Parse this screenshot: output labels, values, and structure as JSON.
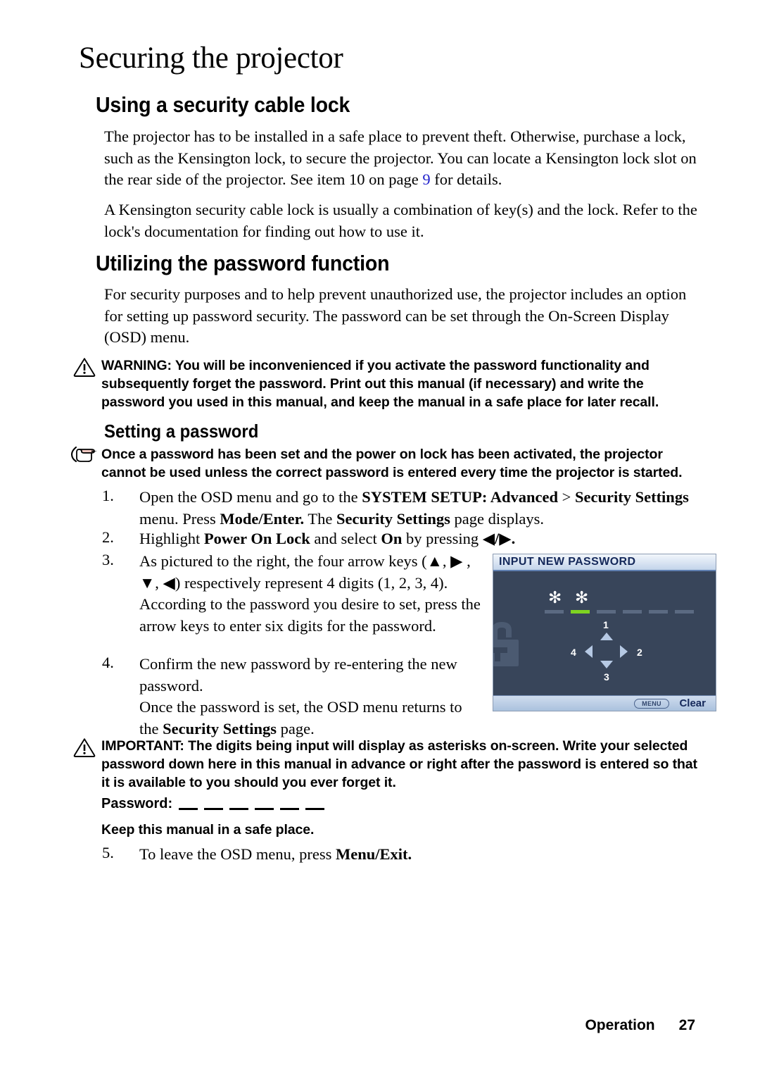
{
  "page": {
    "title": "Securing the projector",
    "footer": {
      "section": "Operation",
      "page_number": "27"
    }
  },
  "sections": [
    {
      "heading": "Using a security cable lock",
      "paragraphs": [
        {
          "pre": "The projector has to be installed in a safe place to prevent theft. Otherwise, purchase a lock, such as the Kensington lock, to secure the projector. You can locate a Kensington lock slot on the rear side of the projector. See item 10 on page ",
          "link": "9",
          "post": " for details."
        },
        {
          "pre": "A Kensington security cable lock is usually a combination of key(s) and the lock. Refer to the lock's documentation for finding out how to use it.",
          "link": "",
          "post": ""
        }
      ]
    },
    {
      "heading": "Utilizing the password function",
      "paragraphs": [
        {
          "pre": "For security purposes and to help prevent unauthorized use, the projector includes an option for setting up password security. The password can be set through the On-Screen Display (OSD) menu.",
          "link": "",
          "post": ""
        }
      ]
    }
  ],
  "warning_note": {
    "icon": "warning-triangle-icon",
    "text": "WARNING: You will be inconvenienced if you activate the password functionality and subsequently forget the password. Print out this manual (if necessary) and write the password you used in this manual, and keep the manual in a safe place for later recall."
  },
  "subheading": "Setting a password",
  "tip_note": {
    "icon": "pointing-hand-icon",
    "text": "Once a password has been set and the power on lock has been activated, the projector cannot be used unless the correct password is entered every time the projector is started."
  },
  "steps": [
    {
      "number": "1.",
      "parts": [
        {
          "t": "Open the OSD menu and go to the ",
          "b": false
        },
        {
          "t": "SYSTEM SETUP: Advanced",
          "b": true
        },
        {
          "t": " > ",
          "b": false
        },
        {
          "t": "Security Settings",
          "b": true
        },
        {
          "t": " menu. Press ",
          "b": false
        },
        {
          "t": "Mode/Enter.",
          "b": true
        },
        {
          "t": " The ",
          "b": false
        },
        {
          "t": "Security Settings",
          "b": true
        },
        {
          "t": " page displays.",
          "b": false
        }
      ]
    },
    {
      "number": "2.",
      "parts": [
        {
          "t": "Highlight ",
          "b": false
        },
        {
          "t": "Power On Lock",
          "b": true
        },
        {
          "t": " and select ",
          "b": false
        },
        {
          "t": "On",
          "b": true
        },
        {
          "t": " by pressing ",
          "b": false
        },
        {
          "t": "◀/▶.",
          "b": true
        }
      ]
    },
    {
      "number": "3.",
      "parts": [
        {
          "t": "As pictured to the right, the four arrow keys (▲, ▶ , ▼, ◀) respectively represent 4 digits (1, 2, 3, 4). According to the password you desire to set, press the arrow keys to enter six digits for the password.",
          "b": false
        }
      ]
    },
    {
      "number": "4.",
      "parts": [
        {
          "t": "Confirm the new password by re-entering the new password.",
          "b": false
        }
      ]
    },
    {
      "number": "5.",
      "parts": [
        {
          "t": "To leave the OSD menu, press ",
          "b": false
        },
        {
          "t": "Menu/Exit.",
          "b": true
        }
      ]
    }
  ],
  "step4_continuation": [
    {
      "t": "Once the password is set, the OSD menu returns to the ",
      "b": false
    },
    {
      "t": "Security Settings",
      "b": true
    },
    {
      "t": " page.",
      "b": false
    }
  ],
  "important_note": {
    "icon": "warning-triangle-icon",
    "text": "IMPORTANT: The digits being input will display as asterisks on-screen. Write your selected password down here in this manual in advance or right after the password is entered so that it is available to you should you ever forget it."
  },
  "password_record": {
    "label": "Password:",
    "blank_count": 6,
    "keep_note": "Keep this manual in a safe place."
  },
  "osd_screenshot": {
    "title": "INPUT NEW PASSWORD",
    "entered_asterisks": [
      "✻",
      "✻"
    ],
    "slot_count": 6,
    "active_slot_index": 2,
    "active_color": "#7ed321",
    "pad": {
      "up_label": "1",
      "right_label": "2",
      "down_label": "3",
      "left_label": "4"
    },
    "footer": {
      "menu_key": "MENU",
      "action": "Clear"
    },
    "watermark_icon": "padlock-icon",
    "background_color": "#38455a"
  }
}
